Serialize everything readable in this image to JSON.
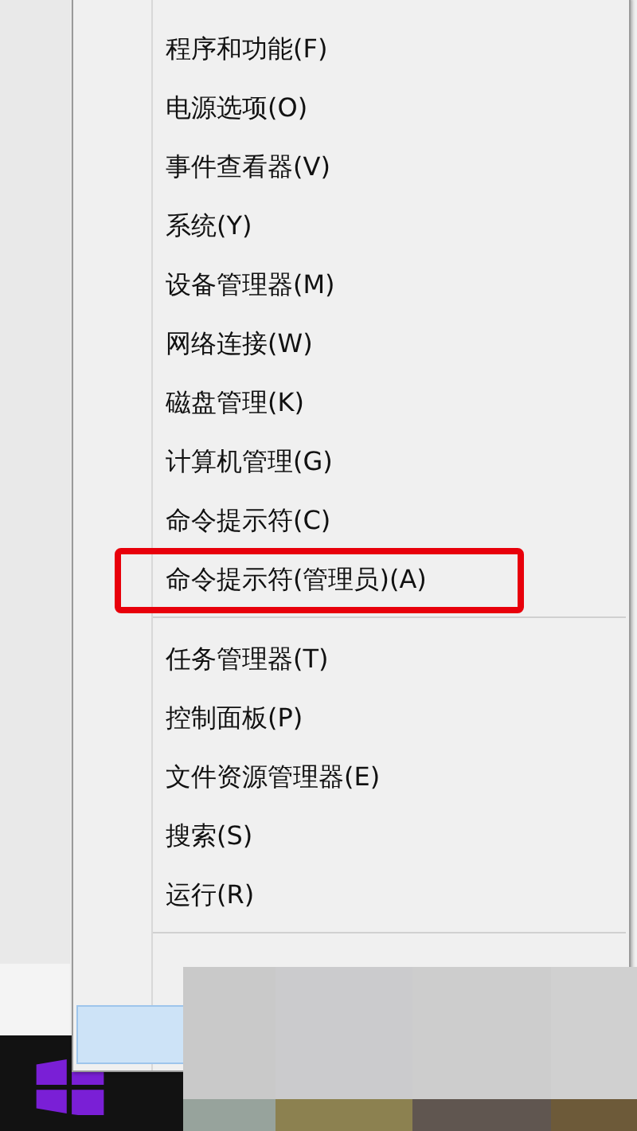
{
  "menu": {
    "groups": [
      {
        "items": [
          {
            "label": "程序和功能(F)",
            "highlighted": false
          },
          {
            "label": "电源选项(O)",
            "highlighted": false
          },
          {
            "label": "事件查看器(V)",
            "highlighted": false
          },
          {
            "label": "系统(Y)",
            "highlighted": false
          },
          {
            "label": "设备管理器(M)",
            "highlighted": false
          },
          {
            "label": "网络连接(W)",
            "highlighted": false
          },
          {
            "label": "磁盘管理(K)",
            "highlighted": false
          },
          {
            "label": "计算机管理(G)",
            "highlighted": false
          },
          {
            "label": "命令提示符(C)",
            "highlighted": false
          },
          {
            "label": "命令提示符(管理员)(A)",
            "highlighted": true
          }
        ]
      },
      {
        "items": [
          {
            "label": "任务管理器(T)",
            "highlighted": false
          },
          {
            "label": "控制面板(P)",
            "highlighted": false
          },
          {
            "label": "文件资源管理器(E)",
            "highlighted": false
          },
          {
            "label": "搜索(S)",
            "highlighted": false
          },
          {
            "label": "运行(R)",
            "highlighted": false
          }
        ]
      },
      {
        "items": [
          {
            "selected": false
          },
          {
            "selected": true
          }
        ]
      }
    ]
  }
}
